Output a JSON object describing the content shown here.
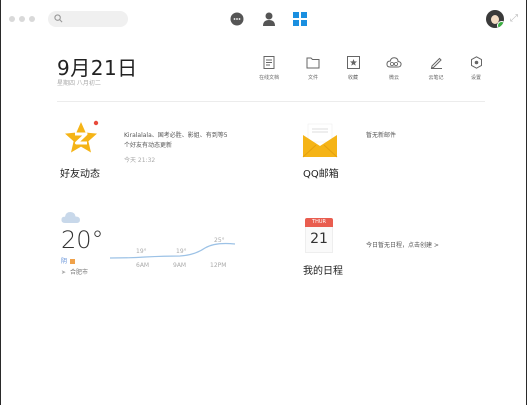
{
  "toolbar": {
    "nav_icons": [
      "chat-bubble-icon",
      "contacts-icon",
      "apps-grid-icon"
    ],
    "accent": "#1a8fe0"
  },
  "header": {
    "date": "9月21日",
    "subdate": "星期四  八月初二"
  },
  "tools": [
    {
      "label": "在线文档",
      "icon": "document-icon"
    },
    {
      "label": "文件",
      "icon": "folder-icon"
    },
    {
      "label": "收藏",
      "icon": "favorite-icon"
    },
    {
      "label": "微云",
      "icon": "cloud-icon"
    },
    {
      "label": "云笔记",
      "icon": "pen-icon"
    },
    {
      "label": "设置",
      "icon": "settings-icon"
    }
  ],
  "feed": {
    "title": "好友动态",
    "text_line1": "Kiralalala、国考必胜、影姐、有到等5",
    "text_line2": "个好友有动态更新",
    "time": "今天 21:32"
  },
  "mail": {
    "title": "QQ邮箱",
    "status": "暂无新邮件"
  },
  "weather": {
    "temperature": "20°",
    "condition": "阴",
    "location": "合肥市",
    "forecast": [
      {
        "temp": "19°",
        "time": "6AM"
      },
      {
        "temp": "19°",
        "time": "9AM"
      },
      {
        "temp": "25°",
        "time": "12PM"
      }
    ]
  },
  "schedule": {
    "weekday": "THUR",
    "day": "21",
    "title": "我的日程",
    "hint": "今日暂无日程，点击创建 >"
  }
}
